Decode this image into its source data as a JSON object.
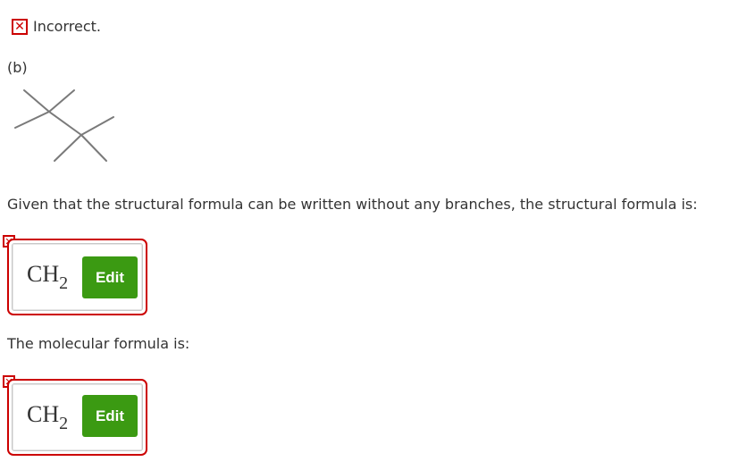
{
  "status": {
    "icon": "x-mark-icon",
    "text": "Incorrect.",
    "color": "#cc0000"
  },
  "part_label": "(b)",
  "molecule": {
    "icon": "skeletal-structure-diagram"
  },
  "question_structural": "Given that the structural formula can be written without any branches, the structural formula is:",
  "answer_structural": {
    "formula_main": "CH",
    "formula_sub": "2",
    "edit_label": "Edit",
    "status": "incorrect"
  },
  "question_molecular": "The molecular formula is:",
  "answer_molecular": {
    "formula_main": "CH",
    "formula_sub": "2",
    "edit_label": "Edit",
    "status": "incorrect"
  },
  "colors": {
    "error": "#cc0000",
    "edit_button": "#3b9a12",
    "text": "#333333",
    "bond": "#7a7a7a"
  }
}
